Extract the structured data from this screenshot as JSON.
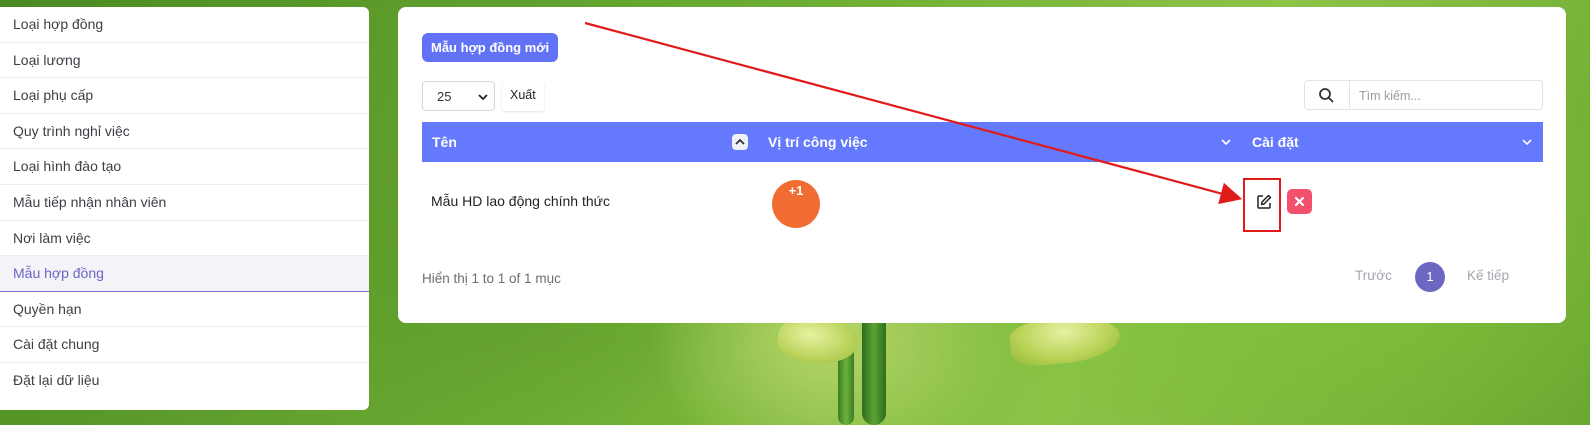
{
  "sidebar": {
    "items": [
      {
        "label": "Loại hợp đồng"
      },
      {
        "label": "Loại lương"
      },
      {
        "label": "Loại phụ cấp"
      },
      {
        "label": "Quy trình nghỉ việc"
      },
      {
        "label": "Loại hình đào tạo"
      },
      {
        "label": "Mẫu tiếp nhận nhân viên"
      },
      {
        "label": "Nơi làm việc"
      },
      {
        "label": "Mẫu hợp đồng",
        "active": true
      },
      {
        "label": "Quyền hạn"
      },
      {
        "label": "Cài đặt chung"
      },
      {
        "label": "Đặt lại dữ liệu"
      }
    ]
  },
  "toolbar": {
    "new_button": "Mẫu hợp đồng mới",
    "page_size": "25",
    "export_label": "Xuất",
    "search_placeholder": "Tìm kiếm..."
  },
  "table": {
    "columns": [
      "Tên",
      "Vị trí công việc",
      "Cài đặt"
    ],
    "rows": [
      {
        "name": "Mẫu HD lao động chính thức",
        "positions_badge": "+1"
      }
    ]
  },
  "pagination": {
    "info": "Hiển thị 1 to 1 of 1 mục",
    "prev": "Trước",
    "current": "1",
    "next": "Kế tiếp"
  },
  "colors": {
    "primary": "#6272f7",
    "header": "#6479fb",
    "badge": "#f16c32",
    "delete": "#f2506c",
    "annotation": "#e11a1a"
  }
}
